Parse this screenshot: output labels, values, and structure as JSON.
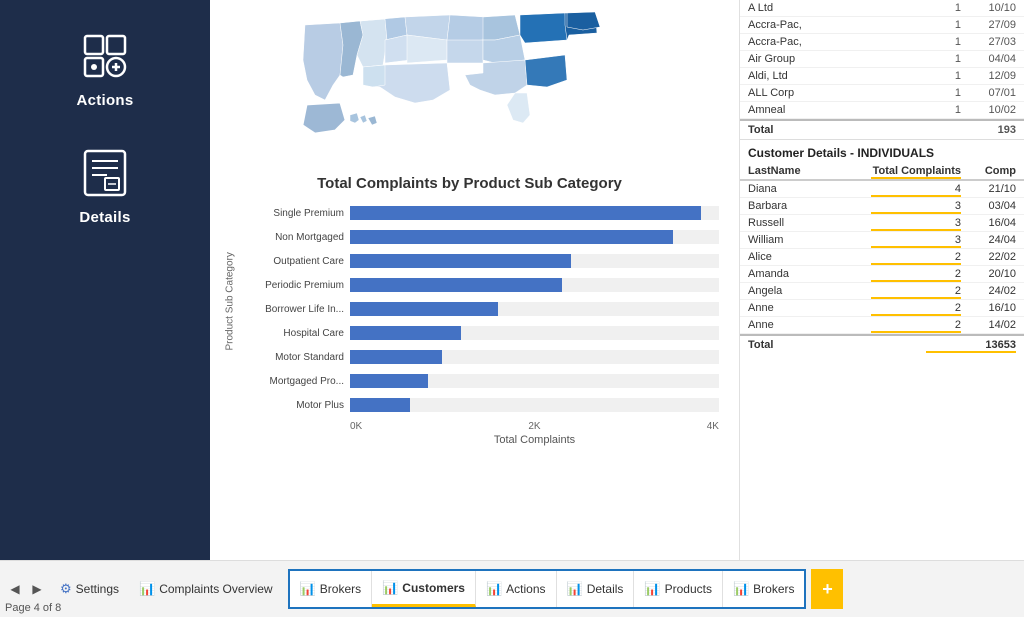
{
  "sidebar": {
    "items": [
      {
        "id": "actions",
        "label": "Actions",
        "icon": "actions-icon"
      },
      {
        "id": "details",
        "label": "Details",
        "icon": "details-icon"
      }
    ]
  },
  "chart": {
    "title": "Total Complaints by Product Sub Category",
    "y_axis_label": "Product Sub Category",
    "x_axis_label": "Total Complaints",
    "x_ticks": [
      "0K",
      "2K",
      "4K"
    ],
    "max_value": 4000,
    "bars": [
      {
        "label": "Single Premium",
        "value": 3800
      },
      {
        "label": "Non Mortgaged",
        "value": 3500
      },
      {
        "label": "Outpatient Care",
        "value": 2400
      },
      {
        "label": "Periodic Premium",
        "value": 2300
      },
      {
        "label": "Borrower Life In...",
        "value": 1600
      },
      {
        "label": "Hospital Care",
        "value": 1200
      },
      {
        "label": "Motor Standard",
        "value": 1000
      },
      {
        "label": "Mortgaged Pro...",
        "value": 850
      },
      {
        "label": "Motor Plus",
        "value": 650
      }
    ]
  },
  "companies_table": {
    "rows": [
      {
        "name": "A Ltd",
        "count": 1,
        "date": "10/10"
      },
      {
        "name": "Accra-Pac,",
        "count": 1,
        "date": "27/09"
      },
      {
        "name": "Accra-Pac,",
        "count": 1,
        "date": "27/03"
      },
      {
        "name": "Air Group",
        "count": 1,
        "date": "04/04"
      },
      {
        "name": "Aldi, Ltd",
        "count": 1,
        "date": "12/09"
      },
      {
        "name": "ALL Corp",
        "count": 1,
        "date": "07/01"
      },
      {
        "name": "Amneal",
        "count": 1,
        "date": "10/02"
      }
    ],
    "total_label": "Total",
    "total_count": 193
  },
  "individuals_section": {
    "title": "Customer Details - INDIVIDUALS",
    "header": {
      "col1": "LastName",
      "col2": "Total Complaints",
      "col3": "Comp"
    },
    "rows": [
      {
        "name": "Diana",
        "complaints": 4,
        "comp": "21/10"
      },
      {
        "name": "Barbara",
        "complaints": 3,
        "comp": "03/04"
      },
      {
        "name": "Russell",
        "complaints": 3,
        "comp": "16/04"
      },
      {
        "name": "William",
        "complaints": 3,
        "comp": "24/04"
      },
      {
        "name": "Alice",
        "complaints": 2,
        "comp": "22/02"
      },
      {
        "name": "Amanda",
        "complaints": 2,
        "comp": "20/10"
      },
      {
        "name": "Angela",
        "complaints": 2,
        "comp": "24/02"
      },
      {
        "name": "Anne",
        "complaints": 2,
        "comp": "16/10"
      },
      {
        "name": "Anne",
        "complaints": 2,
        "comp": "14/02"
      }
    ],
    "total_label": "Total",
    "total_complaints": 13653
  },
  "bottom_bar": {
    "page_info": "Page 4 of 8",
    "tabs_outside": [
      {
        "label": "Settings",
        "icon": "settings-icon"
      },
      {
        "label": "Complaints Overview",
        "icon": "complaints-icon"
      }
    ],
    "tabs_group": [
      {
        "label": "Brokers",
        "icon": "tab-icon",
        "active": false
      },
      {
        "label": "Customers",
        "icon": "tab-icon",
        "active": true
      },
      {
        "label": "Actions",
        "icon": "tab-icon",
        "active": false
      },
      {
        "label": "Details",
        "icon": "tab-icon",
        "active": false
      },
      {
        "label": "Products",
        "icon": "tab-icon",
        "active": false
      },
      {
        "label": "Brokers",
        "icon": "tab-icon",
        "active": false
      }
    ],
    "add_button_label": "+"
  }
}
